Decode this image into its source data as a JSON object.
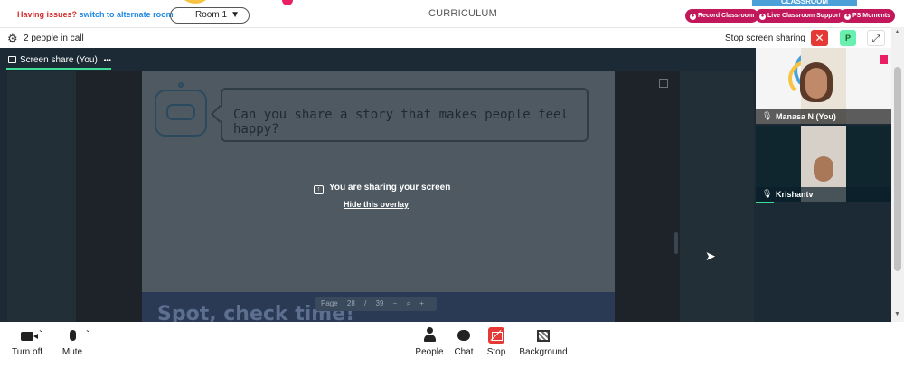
{
  "topbar": {
    "issue_text": "Having issues?",
    "alt_link": "switch to alternate room",
    "room_value": "Room 1",
    "room_caret": "▼",
    "curriculum_label": "CURRICULUM",
    "classroom_tag": "CLASSROOM",
    "pills": [
      {
        "label": "Record Classroom"
      },
      {
        "label": "Live Classroom Support"
      },
      {
        "label": "PS Moments"
      }
    ]
  },
  "callbar": {
    "people_count": "2 people in call",
    "stop_share_label": "Stop screen sharing",
    "close_glyph": "✕",
    "avatar_letter": "P",
    "expand_glyph": "⤢",
    "gear_glyph": "⚙"
  },
  "share": {
    "tab_label": "Screen share (You)",
    "tab_menu": "•••",
    "question": "Can you share a story that makes people feel happy?",
    "sharing_note": "You are sharing your screen",
    "hide_overlay": "Hide this overlay",
    "slide_footer_text": "Spot, check time!",
    "pager": {
      "label": "Page",
      "current": "28",
      "separator": "/",
      "total": "39",
      "zoom_out": "−",
      "zoom_in": "+"
    }
  },
  "participants": [
    {
      "name": "Manasa N (You)"
    },
    {
      "name": "Krishantv"
    }
  ],
  "toolbar": {
    "turn_off": "Turn off",
    "mute": "Mute",
    "people": "People",
    "chat": "Chat",
    "stop": "Stop",
    "background": "Background",
    "chevron": "⌄"
  },
  "colors": {
    "accent_green": "#3ddc97",
    "alert_red": "#e53935",
    "pill_pink": "#c2185b",
    "issue_red": "#d32f2f",
    "link_blue": "#1e88e5",
    "call_bg": "#1b2a34"
  },
  "icons": [
    "gear-icon",
    "close-icon",
    "expand-icon",
    "monitor-icon",
    "robot-icon",
    "upload-icon",
    "mic-icon",
    "camera-icon",
    "people-icon",
    "chat-icon",
    "stop-share-icon",
    "background-icon",
    "zoom-icon",
    "popout-icon"
  ]
}
